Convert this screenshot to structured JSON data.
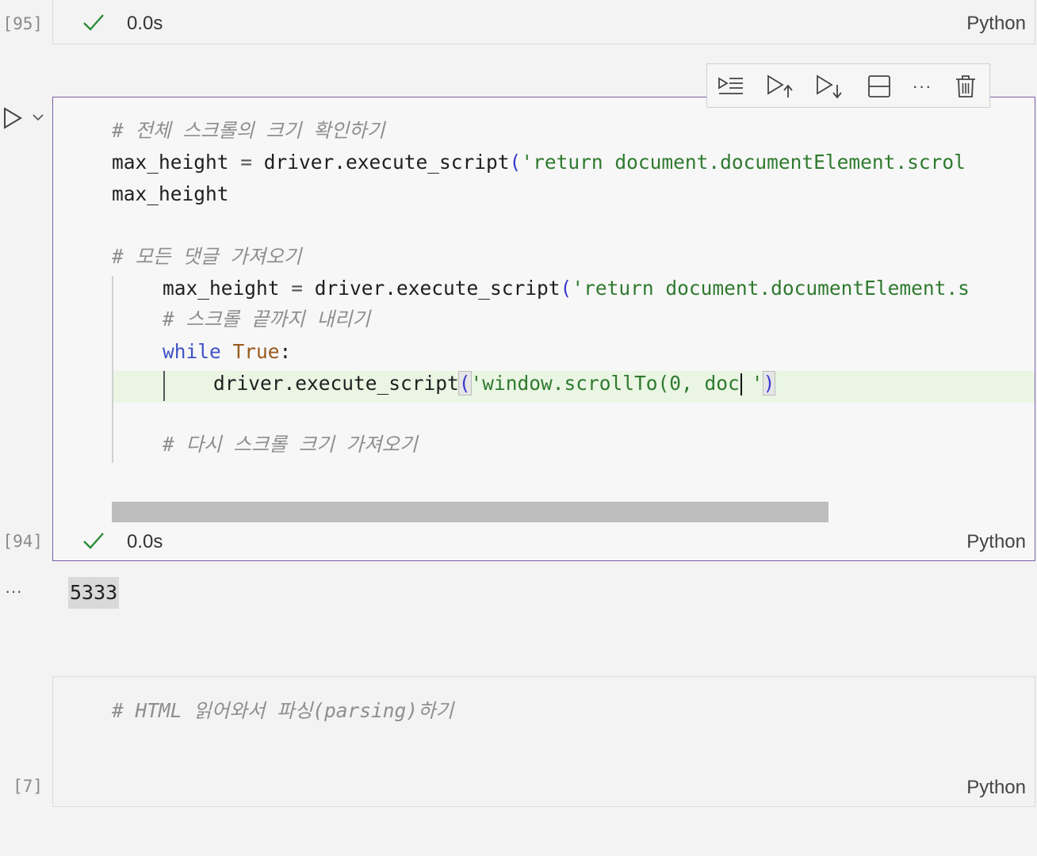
{
  "cells": [
    {
      "exec_count": "[95]",
      "time": "0.0s",
      "language": "Python"
    },
    {
      "exec_count": "[94]",
      "time": "0.0s",
      "language": "Python",
      "code": {
        "comment1": "# 전체 스크롤의 크기 확인하기",
        "line2_var": "max_height",
        "line2_eq": " = ",
        "line2_call": "driver.execute_script",
        "line2_open": "(",
        "line2_str": "'return document.documentElement.scrol",
        "line3": "max_height",
        "comment2": "# 모든 댓글 가져오기",
        "line5_var": "max_height",
        "line5_eq": " = ",
        "line5_call": "driver.execute_script",
        "line5_open": "(",
        "line5_str": "'return document.documentElement.s",
        "comment3": "# 스크롤 끝까지 내리기",
        "while_kw": "while",
        "true_kw": "True",
        "colon": ":",
        "line8_call": "driver.execute_script",
        "line8_open": "(",
        "line8_str": "'window.scrollTo(0, doc",
        "line8_str_end": "'",
        "line8_close": ")",
        "comment4": "# 다시 스크롤 크기 가져오기"
      },
      "output": "5333",
      "output_prefix": "···"
    },
    {
      "exec_count": "[7]",
      "language": "Python",
      "code": {
        "comment": "# HTML 읽어와서 파싱(parsing)하기"
      }
    }
  ],
  "toolbar": {
    "icons": [
      "run-by-line-icon",
      "run-above-icon",
      "run-below-icon",
      "split-cell-icon",
      "more-icon",
      "delete-icon"
    ],
    "more_label": "···"
  },
  "colors": {
    "accent_border": "#7b5ea7",
    "success": "#2e8b3a",
    "string": "#2f7a2f",
    "keyword": "#3f52c7",
    "highlight_line": "#eaf5e4"
  }
}
